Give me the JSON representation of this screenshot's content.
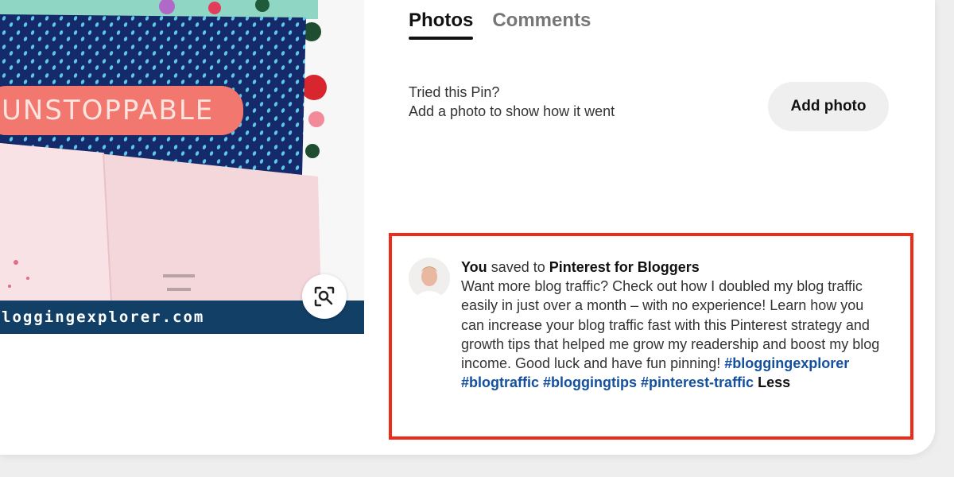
{
  "pin": {
    "banner_text": "UNSTOPPABLE",
    "url_text": "loggingexplorer.com",
    "lens_icon": "visual-search-icon"
  },
  "tabs": [
    {
      "label": "Photos",
      "active": true
    },
    {
      "label": "Comments",
      "active": false
    }
  ],
  "tried": {
    "line1": "Tried this Pin?",
    "line2": "Add a photo to show how it went",
    "button_label": "Add photo"
  },
  "activity": {
    "actor": "You",
    "saved_to_text": "saved to",
    "board": "Pinterest for Bloggers",
    "description": "Want more blog traffic? Check out how I doubled my blog traffic easily in just over a month – with no experience! Learn how you can increase your blog traffic fast with this Pinterest strategy and growth tips that helped me grow my readership and boost my blog income. Good luck and have fun pinning!",
    "hashtags": [
      "#bloggingexplorer",
      "#blogtraffic",
      "#bloggingtips",
      "#pinterest-traffic"
    ],
    "less_label": "Less"
  },
  "colors": {
    "highlight_border": "#ee2a1b",
    "hashtag": "#1450a0",
    "url_bar": "#123f66",
    "banner": "#f2776f"
  }
}
